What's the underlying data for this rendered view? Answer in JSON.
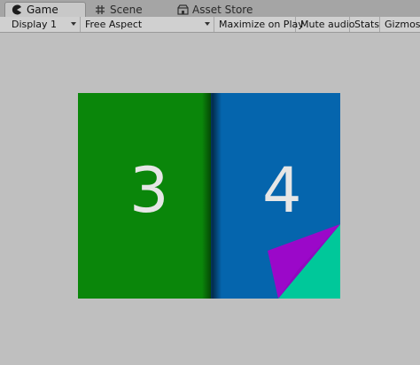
{
  "tabs": [
    {
      "label": "Game",
      "icon": "pacman-icon",
      "active": true
    },
    {
      "label": "Scene",
      "icon": "grid-icon",
      "active": false
    },
    {
      "label": "Asset Store",
      "icon": "store-icon",
      "active": false
    }
  ],
  "toolbar": {
    "display": "Display 1",
    "aspect": "Free Aspect",
    "maximize": "Maximize on Play",
    "mute": "Mute audio",
    "stats": "Stats",
    "gizmos": "Gizmos"
  },
  "game": {
    "left_page_number": "3",
    "right_page_number": "4",
    "colors": {
      "left_page": "#0a860a",
      "right_page": "#0565ad",
      "curl_back": "#9b08c9",
      "revealed_page": "#00c89a"
    }
  }
}
